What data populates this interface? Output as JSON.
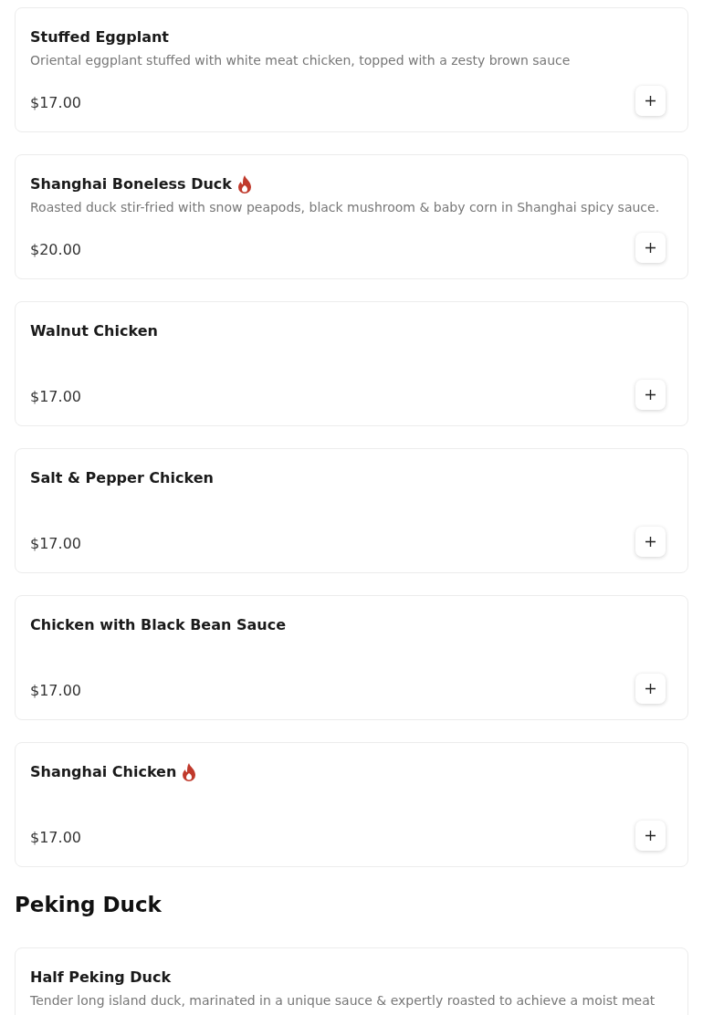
{
  "sections": [
    {
      "items": [
        {
          "name": "Stuffed Eggplant",
          "spicy": false,
          "description": "Oriental eggplant stuffed with white meat chicken, topped with a zesty brown sauce",
          "price": "$17.00"
        },
        {
          "name": "Shanghai Boneless Duck",
          "spicy": true,
          "description": "Roasted duck stir-fried with snow peapods, black mushroom & baby corn in Shanghai spicy sauce.",
          "price": "$20.00"
        },
        {
          "name": "Walnut Chicken",
          "spicy": false,
          "price": "$17.00"
        },
        {
          "name": "Salt & Pepper Chicken",
          "spicy": false,
          "price": "$17.00"
        },
        {
          "name": "Chicken with Black Bean Sauce",
          "spicy": false,
          "price": "$17.00"
        },
        {
          "name": "Shanghai Chicken",
          "spicy": true,
          "price": "$17.00"
        }
      ]
    },
    {
      "title": "Peking Duck",
      "items": [
        {
          "name": "Half Peking Duck",
          "spicy": false,
          "description": "Tender long island duck, marinated in a unique sauce & expertly roasted to achieve a moist meat"
        }
      ]
    }
  ]
}
